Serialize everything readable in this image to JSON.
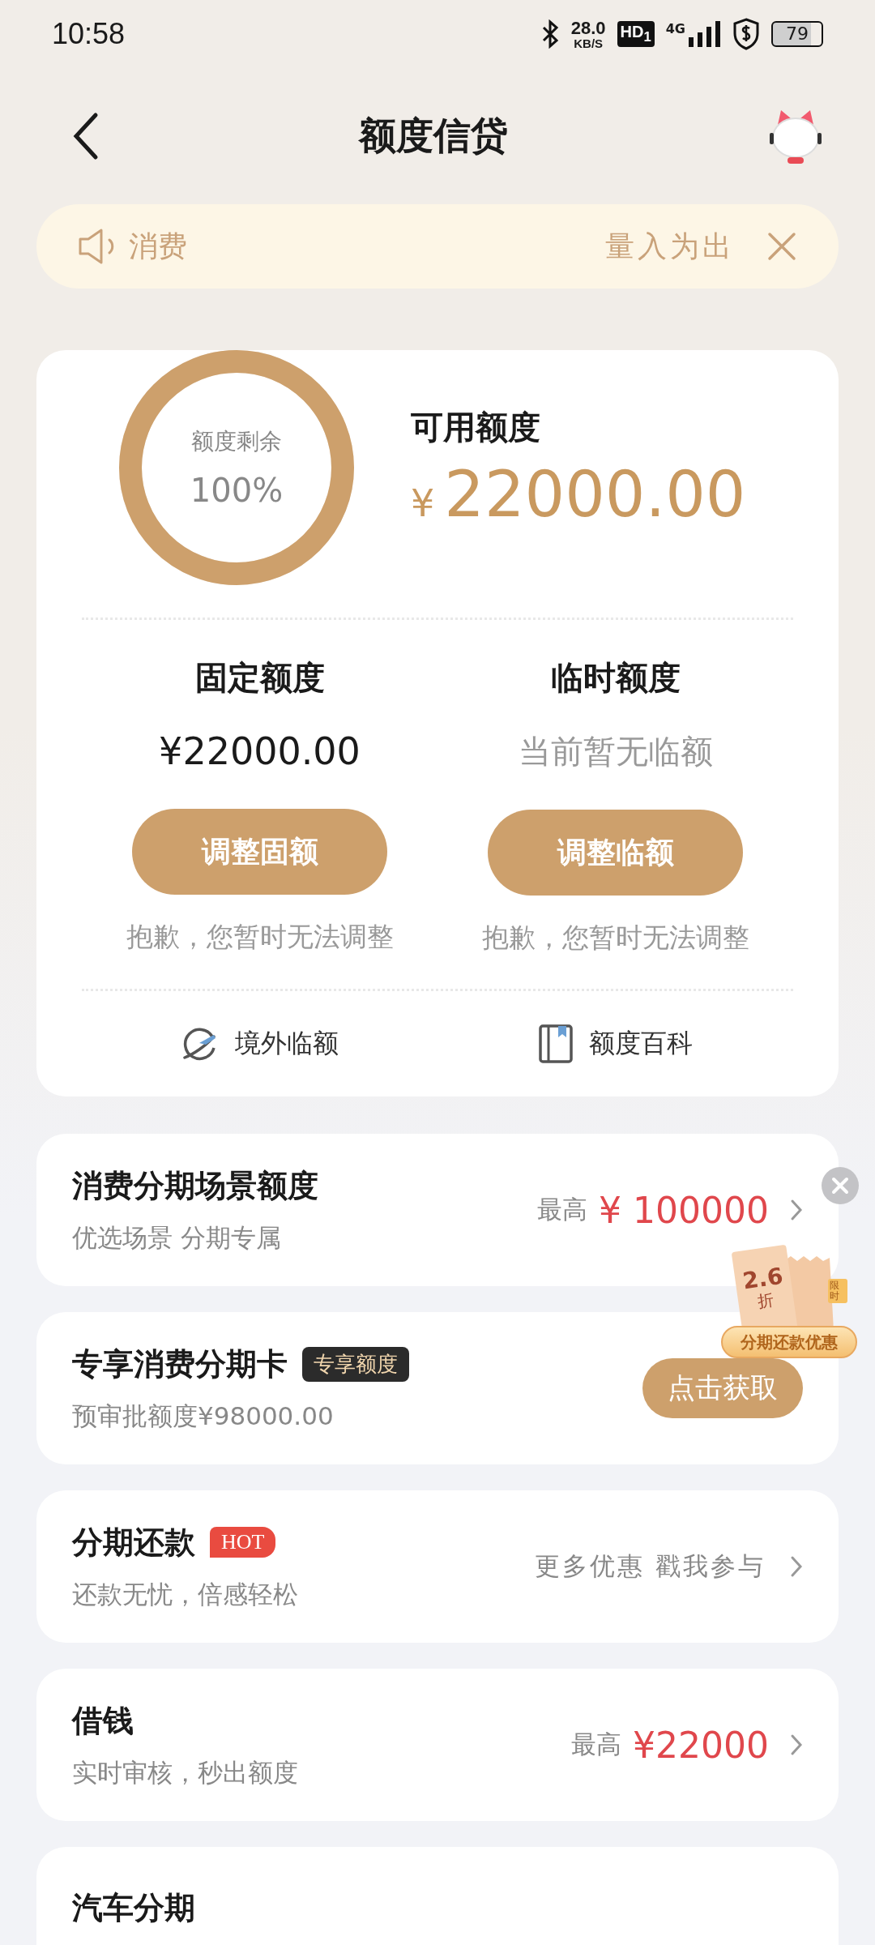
{
  "status_bar": {
    "time": "10:58",
    "net_speed": "28.0",
    "net_unit": "KB/S",
    "hd_badge": "HD$_{1}$",
    "network": "4G",
    "battery": "79"
  },
  "header": {
    "title": "额度信贷"
  },
  "notice": {
    "text": "消费",
    "tail": "量入为出"
  },
  "credit": {
    "ring_label": "额度剩余",
    "ring_value": "100%",
    "level": 1,
    "available_label": "可用额度",
    "currency": "¥",
    "available_amount": "22000.00",
    "quotas": [
      {
        "kind": "amount",
        "title": "固定额度",
        "amount": "¥22000.00",
        "button": "调整固额",
        "note": "抱歉，您暂时无法调整"
      },
      {
        "kind": "empty",
        "title": "临时额度",
        "amount": "当前暂无临额",
        "button": "调整临额",
        "note": "抱歉，您暂时无法调整"
      }
    ],
    "links": [
      "境外临额",
      "额度百科"
    ]
  },
  "cards": [
    {
      "kind": "scene",
      "title": "消费分期场景额度",
      "subtitle": "优选场景 分期专属",
      "prefix": "最高",
      "amount": "¥ 100000"
    },
    {
      "kind": "offer",
      "title": "专享消费分期卡",
      "tag": "专享额度",
      "subtitle": "预审批额度¥98000.00",
      "button": "点击获取"
    },
    {
      "kind": "promo",
      "title": "分期还款",
      "tag": "HOT",
      "subtitle": "还款无忧，倍感轻松",
      "link": "更多优惠 戳我参与"
    },
    {
      "kind": "scene",
      "title": "借钱",
      "subtitle": "实时审核，秒出额度",
      "prefix": "最高",
      "amount": "¥22000"
    },
    {
      "kind": "plain",
      "title": "汽车分期"
    }
  ],
  "floating_promo": {
    "discount": "2.6",
    "unit": "折",
    "tag": "限时",
    "label": "分期还款优惠"
  }
}
